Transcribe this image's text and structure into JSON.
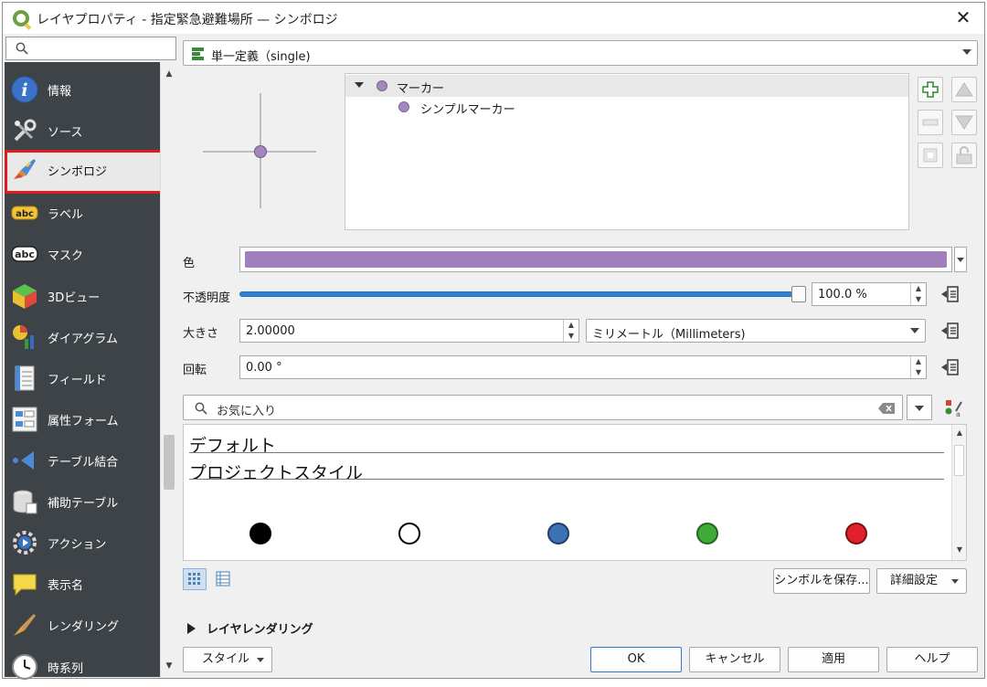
{
  "window": {
    "title": "レイヤプロパティ - 指定緊急避難場所 — シンボロジ",
    "close": "✕"
  },
  "sidebar": {
    "items": [
      {
        "label": "情報",
        "icon": "info-icon"
      },
      {
        "label": "ソース",
        "icon": "source-tools-icon"
      },
      {
        "label": "シンボロジ",
        "icon": "symbology-brush-icon",
        "selected": true
      },
      {
        "label": "ラベル",
        "icon": "label-abc-icon"
      },
      {
        "label": "マスク",
        "icon": "mask-abc-icon"
      },
      {
        "label": "3Dビュー",
        "icon": "cube-3d-icon"
      },
      {
        "label": "ダイアグラム",
        "icon": "diagram-icon"
      },
      {
        "label": "フィールド",
        "icon": "fields-icon"
      },
      {
        "label": "属性フォーム",
        "icon": "attribute-form-icon"
      },
      {
        "label": "テーブル結合",
        "icon": "join-icon"
      },
      {
        "label": "補助テーブル",
        "icon": "auxiliary-storage-icon"
      },
      {
        "label": "アクション",
        "icon": "action-gear-icon"
      },
      {
        "label": "表示名",
        "icon": "display-speech-icon"
      },
      {
        "label": "レンダリング",
        "icon": "rendering-brush-icon"
      },
      {
        "label": "時系列",
        "icon": "clock-icon"
      }
    ],
    "highlight_color": "#e01b1b"
  },
  "renderer": {
    "selected": "単一定義（single)"
  },
  "symbol_tree": {
    "root": "マーカー",
    "child": "シンプルマーカー",
    "marker_color": "#a487c0"
  },
  "properties": {
    "color_label": "色",
    "color_value": "#a07fbd",
    "opacity_label": "不透明度",
    "opacity_value": "100.0 %",
    "opacity_fraction": 1.0,
    "size_label": "大きさ",
    "size_value": "2.00000",
    "size_unit": "ミリメートル（Millimeters)",
    "rotation_label": "回転",
    "rotation_value": "0.00 °"
  },
  "library": {
    "search_placeholder": "お気に入り",
    "groups": [
      "デフォルト",
      "プロジェクトスタイル"
    ],
    "symbols": [
      {
        "name": "black",
        "fill": "#000000",
        "stroke": "#000000"
      },
      {
        "name": "white",
        "fill": "#ffffff",
        "stroke": "#000000"
      },
      {
        "name": "blue",
        "fill": "#3c72b4",
        "stroke": "#223d66"
      },
      {
        "name": "green",
        "fill": "#3daa3a",
        "stroke": "#236622"
      },
      {
        "name": "red",
        "fill": "#e0202a",
        "stroke": "#7a1012"
      }
    ]
  },
  "actions": {
    "save_symbol": "シンボルを保存...",
    "advanced": "詳細設定",
    "layer_rendering": "レイヤレンダリング",
    "style": "スタイル",
    "ok": "OK",
    "cancel": "キャンセル",
    "apply": "適用",
    "help": "ヘルプ"
  }
}
